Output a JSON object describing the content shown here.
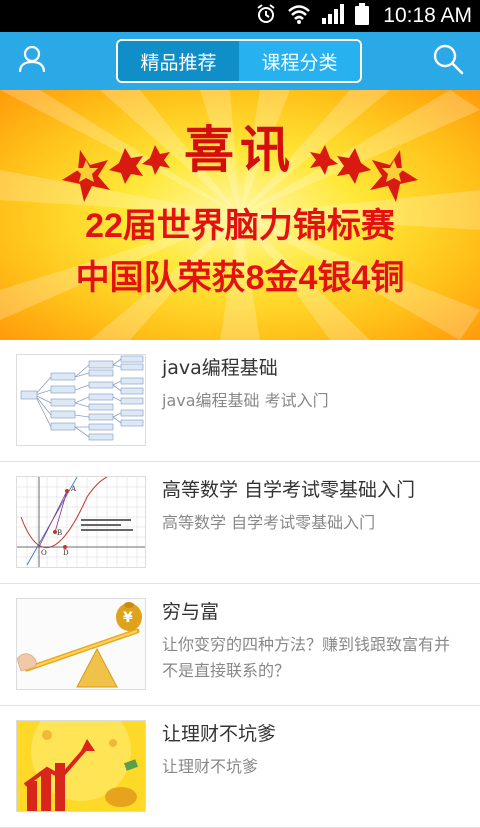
{
  "status_bar": {
    "time": "10:18 AM"
  },
  "header": {
    "tabs": [
      {
        "label": "精品推荐",
        "active": true
      },
      {
        "label": "课程分类",
        "active": false
      }
    ]
  },
  "banner": {
    "headline": "喜讯",
    "line1": "22届世界脑力锦标赛",
    "line2": "中国队荣获8金4银4铜"
  },
  "courses": [
    {
      "title": "java编程基础",
      "description": "java编程基础 考试入门"
    },
    {
      "title": "高等数学 自学考试零基础入门",
      "description": "高等数学 自学考试零基础入门"
    },
    {
      "title": "穷与富",
      "description": "让你变穷的四种方法？赚到钱跟致富有并不是直接联系的？"
    },
    {
      "title": "让理财不坑爹",
      "description": "让理财不坑爹"
    }
  ],
  "colors": {
    "header": "#2ba9e6",
    "tab_active": "#0f8ec7",
    "banner_text": "#e4120f"
  }
}
